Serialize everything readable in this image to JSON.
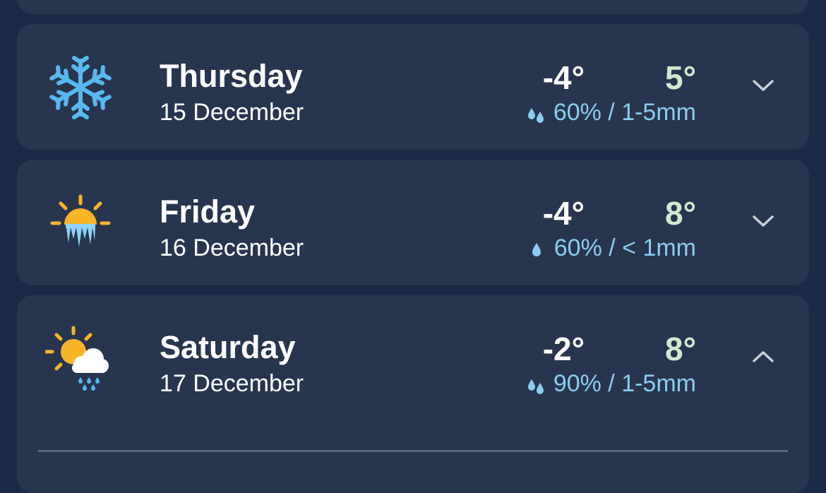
{
  "forecast": {
    "days": [
      {
        "day": "Thursday",
        "date": "15 December",
        "temp_min": "-4°",
        "temp_max": "5°",
        "precip": "60% / 1-5mm",
        "weather_icon": "snowflake-icon",
        "expanded": false
      },
      {
        "day": "Friday",
        "date": "16 December",
        "temp_min": "-4°",
        "temp_max": "8°",
        "precip": "60% / < 1mm",
        "weather_icon": "sun-icicles-icon",
        "expanded": false
      },
      {
        "day": "Saturday",
        "date": "17 December",
        "temp_min": "-2°",
        "temp_max": "8°",
        "precip": "90% / 1-5mm",
        "weather_icon": "sun-cloud-rain-icon",
        "expanded": true
      }
    ]
  },
  "colors": {
    "background": "#1b2944",
    "card": "#28354f",
    "text": "#ffffff",
    "temp_max": "#cdeccf",
    "precip": "#89cdef",
    "sun": "#f8b52a",
    "snow": "#58b8ef"
  }
}
